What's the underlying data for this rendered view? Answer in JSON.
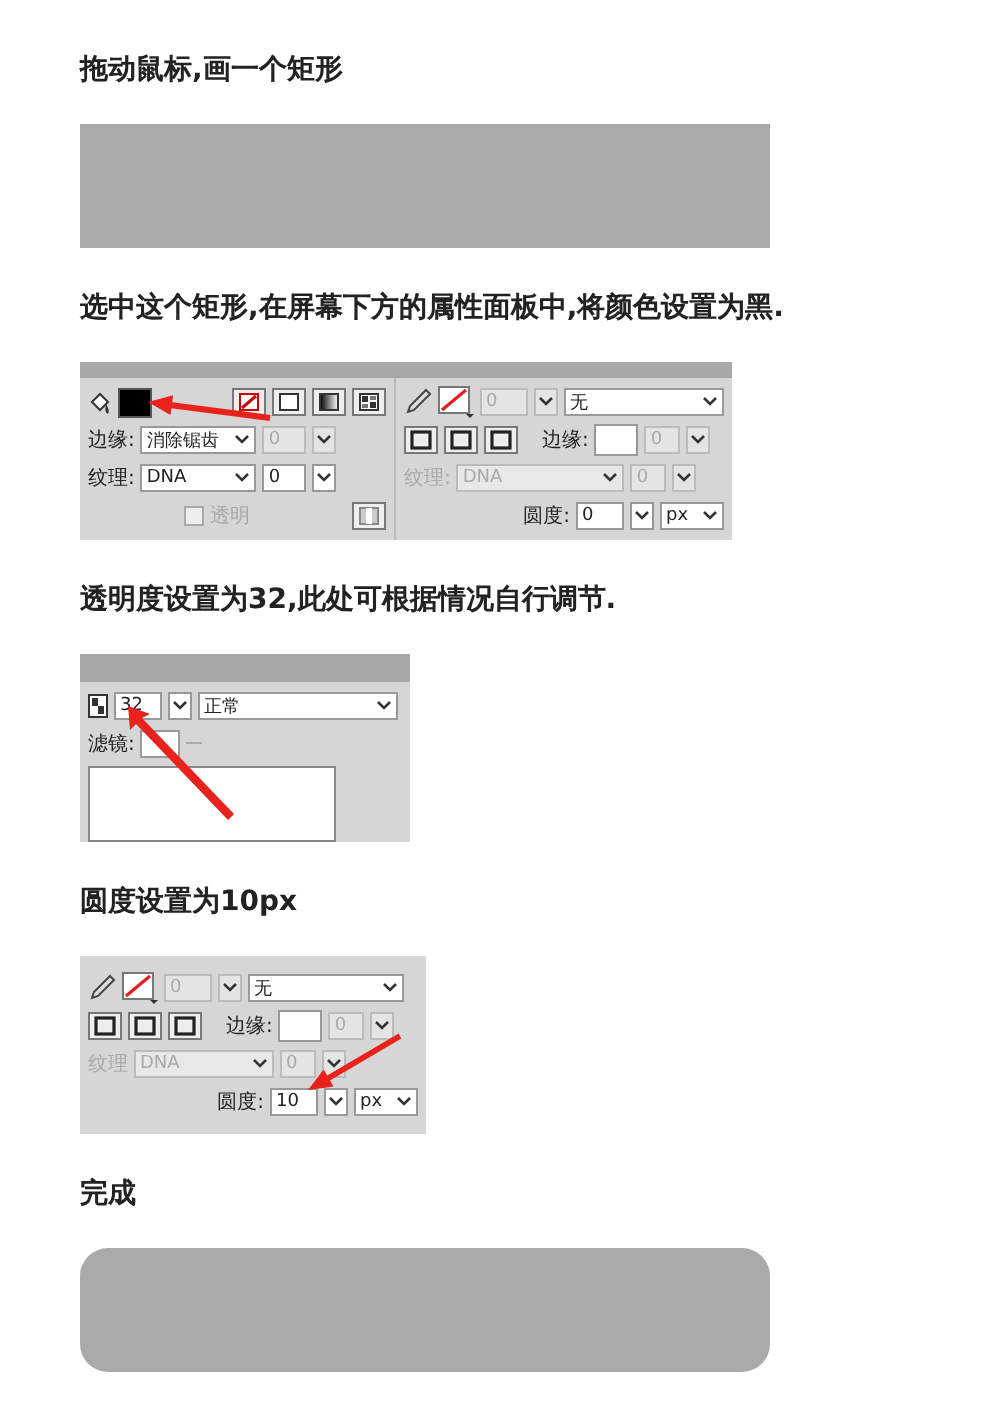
{
  "sections": [
    {
      "caption": "拖动鼠标,画一个矩形",
      "figure": {
        "kind": "rectangle",
        "rounded": false
      }
    },
    {
      "caption": "选中这个矩形,在屏幕下方的属性面板中,将颜色设置为黑.",
      "figure": {
        "kind": "properties_panel",
        "fill": {
          "edge_label": "边缘:",
          "edge_value": "消除锯齿",
          "edge_amount": "0",
          "texture_label": "纹理:",
          "texture_value": "DNA",
          "texture_amount": "0",
          "transparent_label": "透明",
          "transparent_checked": false
        },
        "stroke": {
          "stroke_size": "0",
          "stroke_type": "无",
          "edge_label": "边缘:",
          "edge_amount": "0",
          "texture_label": "纹理:",
          "texture_value": "DNA",
          "texture_amount": "0",
          "texture_disabled": true,
          "roundness_label": "圆度:",
          "roundness_value": "0",
          "unit": "px"
        }
      }
    },
    {
      "caption": "透明度设置为32,此处可根据情况自行调节.",
      "figure": {
        "kind": "opacity_panel",
        "opacity": "32",
        "blend": "正常",
        "filters_label": "滤镜:"
      }
    },
    {
      "caption": "圆度设置为10px",
      "figure": {
        "kind": "stroke_panel",
        "stroke": {
          "stroke_size": "0",
          "stroke_type": "无",
          "edge_label": "边缘:",
          "edge_amount": "0",
          "texture_label": "纹理",
          "texture_value": "DNA",
          "texture_amount": "0",
          "texture_disabled": true,
          "roundness_label": "圆度:",
          "roundness_value": "10",
          "unit": "px"
        }
      }
    },
    {
      "caption": "完成",
      "figure": {
        "kind": "rectangle",
        "rounded": true
      }
    }
  ]
}
